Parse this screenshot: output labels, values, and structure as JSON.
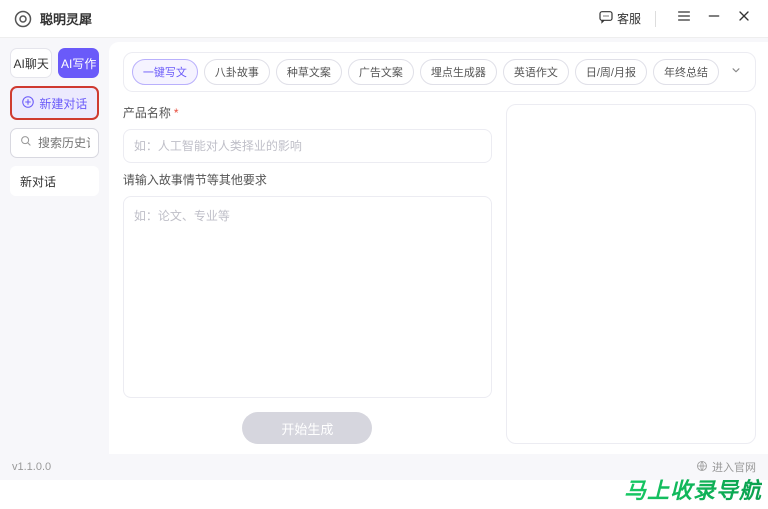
{
  "titlebar": {
    "app_name": "聪明灵犀",
    "support_label": "客服"
  },
  "sidebar": {
    "tabs": {
      "chat": "AI聊天",
      "write": "AI写作"
    },
    "new_chat_label": "新建对话",
    "search_placeholder": "搜索历史记录",
    "history": {
      "0": {
        "label": "新对话"
      }
    }
  },
  "categories": {
    "items": {
      "0": "一键写文",
      "1": "八卦故事",
      "2": "种草文案",
      "3": "广告文案",
      "4": "埋点生成器",
      "5": "英语作文",
      "6": "日/周/月报",
      "7": "年终总结"
    }
  },
  "form": {
    "name_label": "产品名称",
    "required_mark": "*",
    "name_placeholder": "如：人工智能对人类择业的影响",
    "detail_label": "请输入故事情节等其他要求",
    "detail_placeholder": "如：论文、专业等",
    "submit_label": "开始生成"
  },
  "footer": {
    "version": "v1.1.0.0",
    "enter_site_label": "进入官网"
  },
  "watermark": "马上收录导航"
}
